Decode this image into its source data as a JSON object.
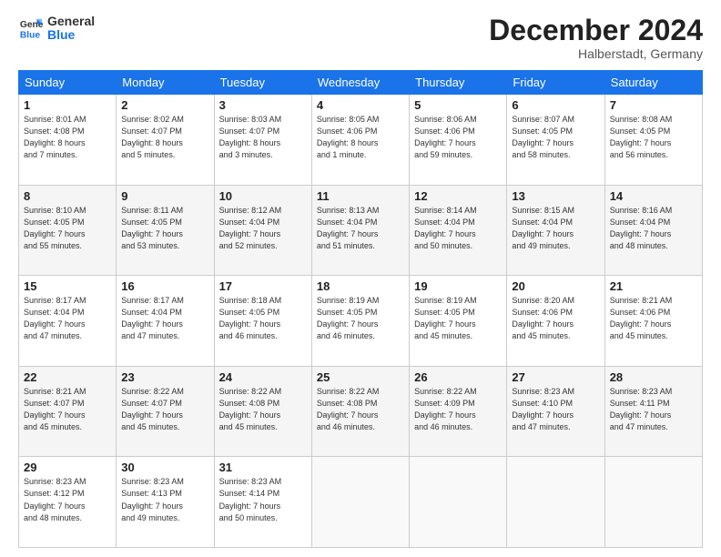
{
  "header": {
    "logo_general": "General",
    "logo_blue": "Blue",
    "month_title": "December 2024",
    "location": "Halberstadt, Germany"
  },
  "days_of_week": [
    "Sunday",
    "Monday",
    "Tuesday",
    "Wednesday",
    "Thursday",
    "Friday",
    "Saturday"
  ],
  "weeks": [
    [
      {
        "day": "1",
        "info": "Sunrise: 8:01 AM\nSunset: 4:08 PM\nDaylight: 8 hours\nand 7 minutes."
      },
      {
        "day": "2",
        "info": "Sunrise: 8:02 AM\nSunset: 4:07 PM\nDaylight: 8 hours\nand 5 minutes."
      },
      {
        "day": "3",
        "info": "Sunrise: 8:03 AM\nSunset: 4:07 PM\nDaylight: 8 hours\nand 3 minutes."
      },
      {
        "day": "4",
        "info": "Sunrise: 8:05 AM\nSunset: 4:06 PM\nDaylight: 8 hours\nand 1 minute."
      },
      {
        "day": "5",
        "info": "Sunrise: 8:06 AM\nSunset: 4:06 PM\nDaylight: 7 hours\nand 59 minutes."
      },
      {
        "day": "6",
        "info": "Sunrise: 8:07 AM\nSunset: 4:05 PM\nDaylight: 7 hours\nand 58 minutes."
      },
      {
        "day": "7",
        "info": "Sunrise: 8:08 AM\nSunset: 4:05 PM\nDaylight: 7 hours\nand 56 minutes."
      }
    ],
    [
      {
        "day": "8",
        "info": "Sunrise: 8:10 AM\nSunset: 4:05 PM\nDaylight: 7 hours\nand 55 minutes."
      },
      {
        "day": "9",
        "info": "Sunrise: 8:11 AM\nSunset: 4:05 PM\nDaylight: 7 hours\nand 53 minutes."
      },
      {
        "day": "10",
        "info": "Sunrise: 8:12 AM\nSunset: 4:04 PM\nDaylight: 7 hours\nand 52 minutes."
      },
      {
        "day": "11",
        "info": "Sunrise: 8:13 AM\nSunset: 4:04 PM\nDaylight: 7 hours\nand 51 minutes."
      },
      {
        "day": "12",
        "info": "Sunrise: 8:14 AM\nSunset: 4:04 PM\nDaylight: 7 hours\nand 50 minutes."
      },
      {
        "day": "13",
        "info": "Sunrise: 8:15 AM\nSunset: 4:04 PM\nDaylight: 7 hours\nand 49 minutes."
      },
      {
        "day": "14",
        "info": "Sunrise: 8:16 AM\nSunset: 4:04 PM\nDaylight: 7 hours\nand 48 minutes."
      }
    ],
    [
      {
        "day": "15",
        "info": "Sunrise: 8:17 AM\nSunset: 4:04 PM\nDaylight: 7 hours\nand 47 minutes."
      },
      {
        "day": "16",
        "info": "Sunrise: 8:17 AM\nSunset: 4:04 PM\nDaylight: 7 hours\nand 47 minutes."
      },
      {
        "day": "17",
        "info": "Sunrise: 8:18 AM\nSunset: 4:05 PM\nDaylight: 7 hours\nand 46 minutes."
      },
      {
        "day": "18",
        "info": "Sunrise: 8:19 AM\nSunset: 4:05 PM\nDaylight: 7 hours\nand 46 minutes."
      },
      {
        "day": "19",
        "info": "Sunrise: 8:19 AM\nSunset: 4:05 PM\nDaylight: 7 hours\nand 45 minutes."
      },
      {
        "day": "20",
        "info": "Sunrise: 8:20 AM\nSunset: 4:06 PM\nDaylight: 7 hours\nand 45 minutes."
      },
      {
        "day": "21",
        "info": "Sunrise: 8:21 AM\nSunset: 4:06 PM\nDaylight: 7 hours\nand 45 minutes."
      }
    ],
    [
      {
        "day": "22",
        "info": "Sunrise: 8:21 AM\nSunset: 4:07 PM\nDaylight: 7 hours\nand 45 minutes."
      },
      {
        "day": "23",
        "info": "Sunrise: 8:22 AM\nSunset: 4:07 PM\nDaylight: 7 hours\nand 45 minutes."
      },
      {
        "day": "24",
        "info": "Sunrise: 8:22 AM\nSunset: 4:08 PM\nDaylight: 7 hours\nand 45 minutes."
      },
      {
        "day": "25",
        "info": "Sunrise: 8:22 AM\nSunset: 4:08 PM\nDaylight: 7 hours\nand 46 minutes."
      },
      {
        "day": "26",
        "info": "Sunrise: 8:22 AM\nSunset: 4:09 PM\nDaylight: 7 hours\nand 46 minutes."
      },
      {
        "day": "27",
        "info": "Sunrise: 8:23 AM\nSunset: 4:10 PM\nDaylight: 7 hours\nand 47 minutes."
      },
      {
        "day": "28",
        "info": "Sunrise: 8:23 AM\nSunset: 4:11 PM\nDaylight: 7 hours\nand 47 minutes."
      }
    ],
    [
      {
        "day": "29",
        "info": "Sunrise: 8:23 AM\nSunset: 4:12 PM\nDaylight: 7 hours\nand 48 minutes."
      },
      {
        "day": "30",
        "info": "Sunrise: 8:23 AM\nSunset: 4:13 PM\nDaylight: 7 hours\nand 49 minutes."
      },
      {
        "day": "31",
        "info": "Sunrise: 8:23 AM\nSunset: 4:14 PM\nDaylight: 7 hours\nand 50 minutes."
      },
      {
        "day": "",
        "info": ""
      },
      {
        "day": "",
        "info": ""
      },
      {
        "day": "",
        "info": ""
      },
      {
        "day": "",
        "info": ""
      }
    ]
  ]
}
